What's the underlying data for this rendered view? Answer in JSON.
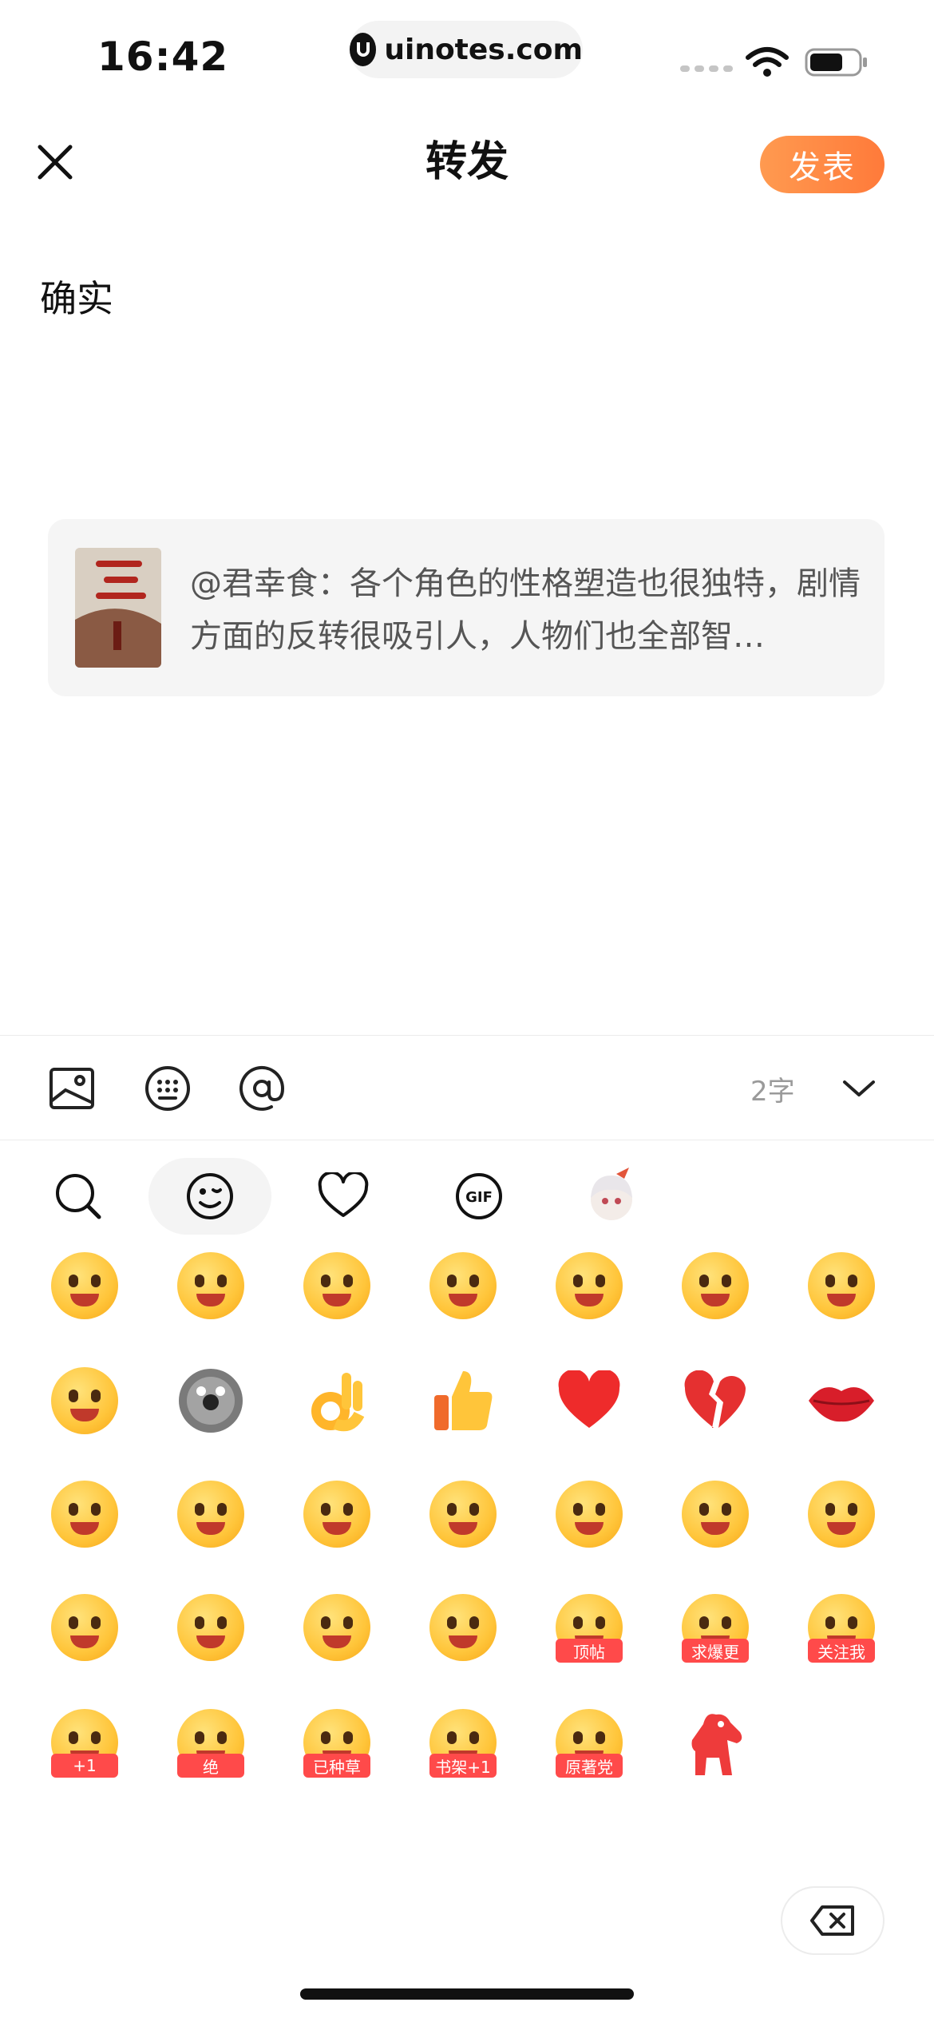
{
  "status_bar": {
    "time": "16:42",
    "url": "uinotes.com"
  },
  "nav": {
    "title": "转发",
    "publish_label": "发表"
  },
  "composer": {
    "text": "确实"
  },
  "quote": {
    "text": "@君幸食：各个角色的性格塑造也很独特，剧情方面的反转很吸引人，人物们也全部智…"
  },
  "toolbar": {
    "char_count": "2字"
  },
  "emoji_tabs": [
    "search",
    "emoji",
    "favorites",
    "gif",
    "sticker-character"
  ],
  "emojis": [
    {
      "name": "laughing-emoji"
    },
    {
      "name": "heart-eyes-emoji"
    },
    {
      "name": "angry-emoji"
    },
    {
      "name": "crying-laughing-emoji"
    },
    {
      "name": "drooling-emoji"
    },
    {
      "name": "screaming-emoji"
    },
    {
      "name": "grinning-squint-emoji"
    },
    {
      "name": "salute-emoji"
    },
    {
      "name": "dizzy-emoji"
    },
    {
      "name": "ok-hand-emoji"
    },
    {
      "name": "thumbs-up-emoji"
    },
    {
      "name": "red-heart-emoji"
    },
    {
      "name": "broken-heart-emoji"
    },
    {
      "name": "lips-emoji"
    },
    {
      "name": "glasses-emoji"
    },
    {
      "name": "magnifier-emoji"
    },
    {
      "name": "thinking-emoji"
    },
    {
      "name": "watermelon-emoji"
    },
    {
      "name": "calm-emoji"
    },
    {
      "name": "smirk-emoji"
    },
    {
      "name": "headband-typing-emoji"
    },
    {
      "name": "writing-emoji"
    },
    {
      "name": "wink-emoji"
    },
    {
      "name": "shocked-emoji"
    },
    {
      "name": "reading-emoji"
    },
    {
      "name": "top-post-emoji",
      "badge": "顶帖"
    },
    {
      "name": "request-update-emoji",
      "badge": "求爆更"
    },
    {
      "name": "follow-me-emoji",
      "badge": "关注我"
    },
    {
      "name": "plus-one-emoji",
      "badge": "+1"
    },
    {
      "name": "amazing-emoji",
      "badge": "绝"
    },
    {
      "name": "planted-grass-emoji",
      "badge": "已种草"
    },
    {
      "name": "bookshelf-plus-one-emoji",
      "badge": "书架+1"
    },
    {
      "name": "original-fan-emoji",
      "badge": "原著党"
    },
    {
      "name": "red-horse-emoji"
    }
  ],
  "colors": {
    "accent": "#ff8a45",
    "card_bg": "#f5f5f5",
    "muted": "#9a9a9a"
  }
}
